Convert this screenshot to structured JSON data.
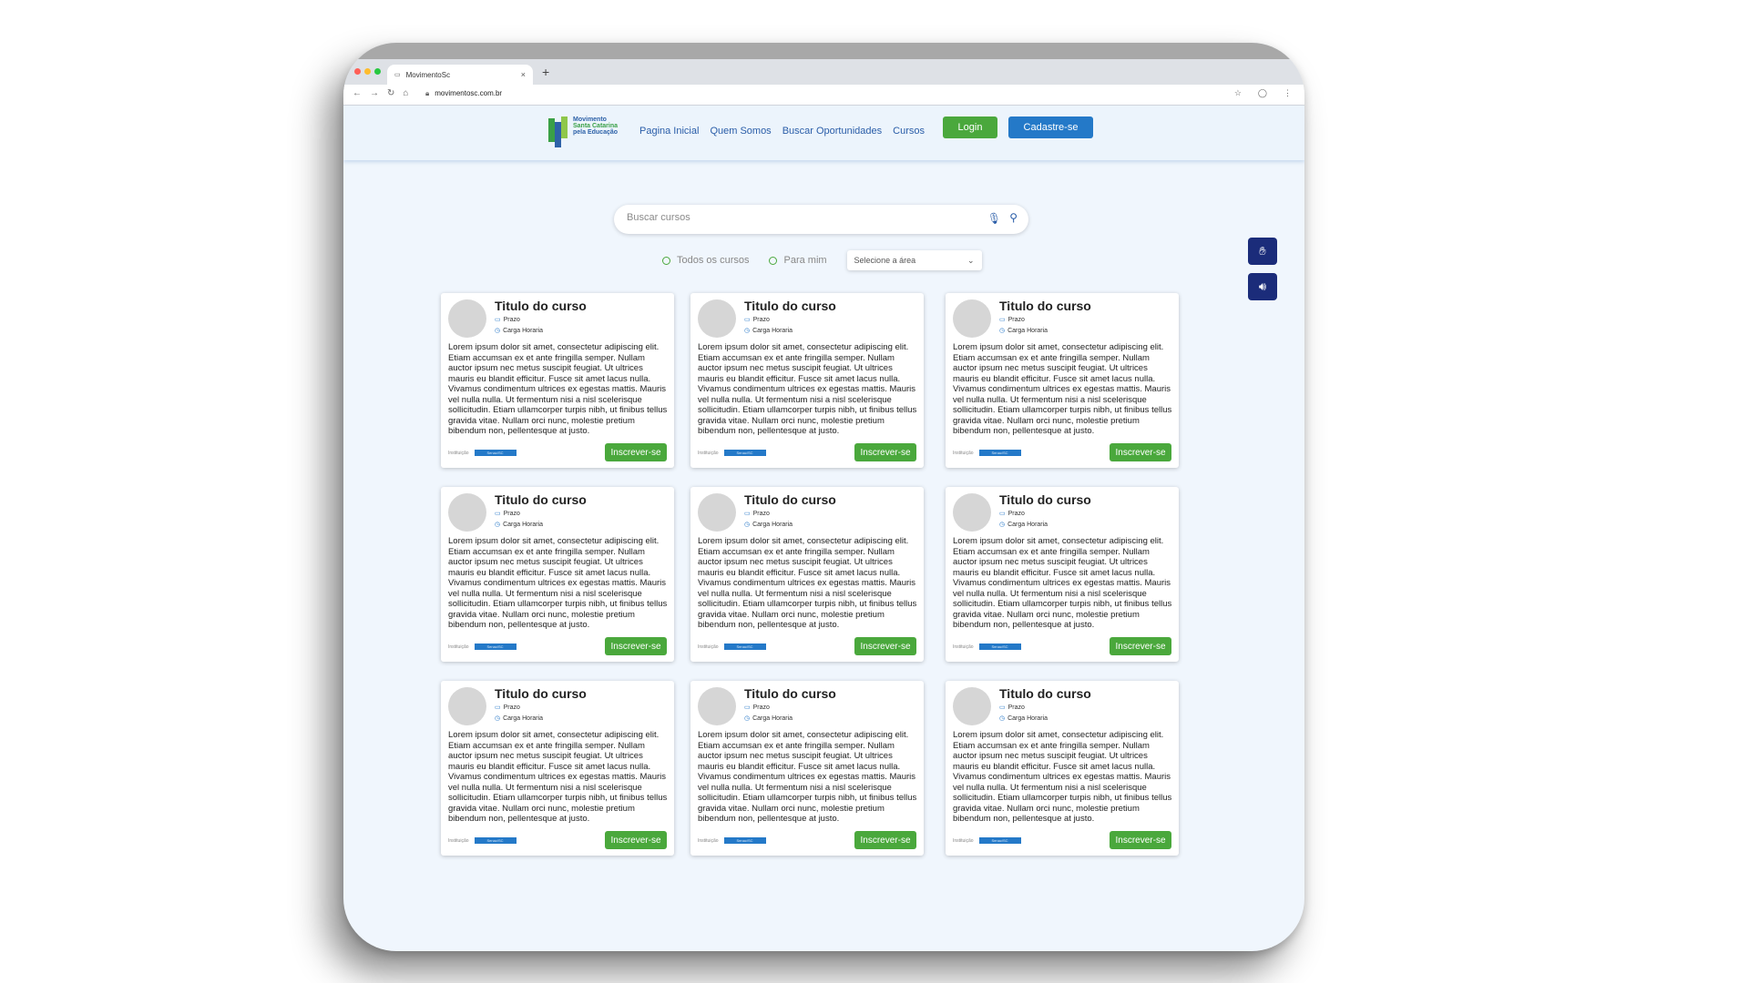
{
  "browser": {
    "tab_title": "MovimentoSc",
    "tab_favicon": "logo-icon",
    "url": "movimentosc.com.br",
    "traffic_light_colors": [
      "#ff5f57",
      "#febc2e",
      "#28c840"
    ]
  },
  "header": {
    "logo_lines": [
      "Movimento",
      "Santa Catarina",
      "pela Educação"
    ],
    "menu": [
      "Pagina Inicial",
      "Quem Somos",
      "Buscar Oportunidades",
      "Cursos"
    ],
    "login_label": "Login",
    "signup_label": "Cadastre-se"
  },
  "search": {
    "placeholder": "Buscar cursos",
    "icons": [
      "mic-icon",
      "search-icon"
    ]
  },
  "filters": {
    "options": [
      "Todos os cursos",
      "Para mim"
    ],
    "select_value": "Selecione a área"
  },
  "side_buttons": [
    "sign-language-icon",
    "audio-reader-icon"
  ],
  "colors": {
    "accent_green": "#4aa83c",
    "accent_blue": "#2479c8",
    "side_button": "#1b2c7a",
    "page_bg": "#f0f6fd"
  },
  "courses": [
    {
      "title": "Titulo do curso",
      "prazo": "Prazo",
      "carga": "Carga Horaria",
      "description": "Lorem ipsum dolor sit amet, consectetur adipiscing elit. Etiam accumsan ex et ante fringilla semper. Nullam auctor ipsum nec metus suscipit feugiat. Ut ultrices mauris eu blandit efficitur. Fusce sit amet lacus nulla. Vivamus condimentum ultrices ex egestas mattis. Mauris vel nulla nulla. Ut fermentum nisi a nisl scelerisque sollicitudin. Etiam ullamcorper turpis nibh, ut finibus tellus gravida vitae. Nullam orci nunc, molestie pretium bibendum non, pellentesque at justo.",
      "institution_label": "Instituição",
      "institution": "Senac/SC",
      "button": "Inscrever-se"
    },
    {
      "title": "Titulo do curso",
      "prazo": "Prazo",
      "carga": "Carga Horaria",
      "description": "Lorem ipsum dolor sit amet, consectetur adipiscing elit. Etiam accumsan ex et ante fringilla semper. Nullam auctor ipsum nec metus suscipit feugiat. Ut ultrices mauris eu blandit efficitur. Fusce sit amet lacus nulla. Vivamus condimentum ultrices ex egestas mattis. Mauris vel nulla nulla. Ut fermentum nisi a nisl scelerisque sollicitudin. Etiam ullamcorper turpis nibh, ut finibus tellus gravida vitae. Nullam orci nunc, molestie pretium bibendum non, pellentesque at justo.",
      "institution_label": "Instituição",
      "institution": "Senac/SC",
      "button": "Inscrever-se"
    },
    {
      "title": "Titulo do curso",
      "prazo": "Prazo",
      "carga": "Carga Horaria",
      "description": "Lorem ipsum dolor sit amet, consectetur adipiscing elit. Etiam accumsan ex et ante fringilla semper. Nullam auctor ipsum nec metus suscipit feugiat. Ut ultrices mauris eu blandit efficitur. Fusce sit amet lacus nulla. Vivamus condimentum ultrices ex egestas mattis. Mauris vel nulla nulla. Ut fermentum nisi a nisl scelerisque sollicitudin. Etiam ullamcorper turpis nibh, ut finibus tellus gravida vitae. Nullam orci nunc, molestie pretium bibendum non, pellentesque at justo.",
      "institution_label": "Instituição",
      "institution": "Senac/SC",
      "button": "Inscrever-se"
    },
    {
      "title": "Titulo do curso",
      "prazo": "Prazo",
      "carga": "Carga Horaria",
      "description": "Lorem ipsum dolor sit amet, consectetur adipiscing elit. Etiam accumsan ex et ante fringilla semper. Nullam auctor ipsum nec metus suscipit feugiat. Ut ultrices mauris eu blandit efficitur. Fusce sit amet lacus nulla. Vivamus condimentum ultrices ex egestas mattis. Mauris vel nulla nulla. Ut fermentum nisi a nisl scelerisque sollicitudin. Etiam ullamcorper turpis nibh, ut finibus tellus gravida vitae. Nullam orci nunc, molestie pretium bibendum non, pellentesque at justo.",
      "institution_label": "Instituição",
      "institution": "Senac/SC",
      "button": "Inscrever-se"
    },
    {
      "title": "Titulo do curso",
      "prazo": "Prazo",
      "carga": "Carga Horaria",
      "description": "Lorem ipsum dolor sit amet, consectetur adipiscing elit. Etiam accumsan ex et ante fringilla semper. Nullam auctor ipsum nec metus suscipit feugiat. Ut ultrices mauris eu blandit efficitur. Fusce sit amet lacus nulla. Vivamus condimentum ultrices ex egestas mattis. Mauris vel nulla nulla. Ut fermentum nisi a nisl scelerisque sollicitudin. Etiam ullamcorper turpis nibh, ut finibus tellus gravida vitae. Nullam orci nunc, molestie pretium bibendum non, pellentesque at justo.",
      "institution_label": "Instituição",
      "institution": "Senac/SC",
      "button": "Inscrever-se"
    },
    {
      "title": "Titulo do curso",
      "prazo": "Prazo",
      "carga": "Carga Horaria",
      "description": "Lorem ipsum dolor sit amet, consectetur adipiscing elit. Etiam accumsan ex et ante fringilla semper. Nullam auctor ipsum nec metus suscipit feugiat. Ut ultrices mauris eu blandit efficitur. Fusce sit amet lacus nulla. Vivamus condimentum ultrices ex egestas mattis. Mauris vel nulla nulla. Ut fermentum nisi a nisl scelerisque sollicitudin. Etiam ullamcorper turpis nibh, ut finibus tellus gravida vitae. Nullam orci nunc, molestie pretium bibendum non, pellentesque at justo.",
      "institution_label": "Instituição",
      "institution": "Senac/SC",
      "button": "Inscrever-se"
    },
    {
      "title": "Titulo do curso",
      "prazo": "Prazo",
      "carga": "Carga Horaria",
      "description": "Lorem ipsum dolor sit amet, consectetur adipiscing elit. Etiam accumsan ex et ante fringilla semper. Nullam auctor ipsum nec metus suscipit feugiat. Ut ultrices mauris eu blandit efficitur. Fusce sit amet lacus nulla. Vivamus condimentum ultrices ex egestas mattis. Mauris vel nulla nulla. Ut fermentum nisi a nisl scelerisque sollicitudin. Etiam ullamcorper turpis nibh, ut finibus tellus gravida vitae. Nullam orci nunc, molestie pretium bibendum non, pellentesque at justo.",
      "institution_label": "Instituição",
      "institution": "Senac/SC",
      "button": "Inscrever-se"
    },
    {
      "title": "Titulo do curso",
      "prazo": "Prazo",
      "carga": "Carga Horaria",
      "description": "Lorem ipsum dolor sit amet, consectetur adipiscing elit. Etiam accumsan ex et ante fringilla semper. Nullam auctor ipsum nec metus suscipit feugiat. Ut ultrices mauris eu blandit efficitur. Fusce sit amet lacus nulla. Vivamus condimentum ultrices ex egestas mattis. Mauris vel nulla nulla. Ut fermentum nisi a nisl scelerisque sollicitudin. Etiam ullamcorper turpis nibh, ut finibus tellus gravida vitae. Nullam orci nunc, molestie pretium bibendum non, pellentesque at justo.",
      "institution_label": "Instituição",
      "institution": "Senac/SC",
      "button": "Inscrever-se"
    },
    {
      "title": "Titulo do curso",
      "prazo": "Prazo",
      "carga": "Carga Horaria",
      "description": "Lorem ipsum dolor sit amet, consectetur adipiscing elit. Etiam accumsan ex et ante fringilla semper. Nullam auctor ipsum nec metus suscipit feugiat. Ut ultrices mauris eu blandit efficitur. Fusce sit amet lacus nulla. Vivamus condimentum ultrices ex egestas mattis. Mauris vel nulla nulla. Ut fermentum nisi a nisl scelerisque sollicitudin. Etiam ullamcorper turpis nibh, ut finibus tellus gravida vitae. Nullam orci nunc, molestie pretium bibendum non, pellentesque at justo.",
      "institution_label": "Instituição",
      "institution": "Senac/SC",
      "button": "Inscrever-se"
    }
  ]
}
